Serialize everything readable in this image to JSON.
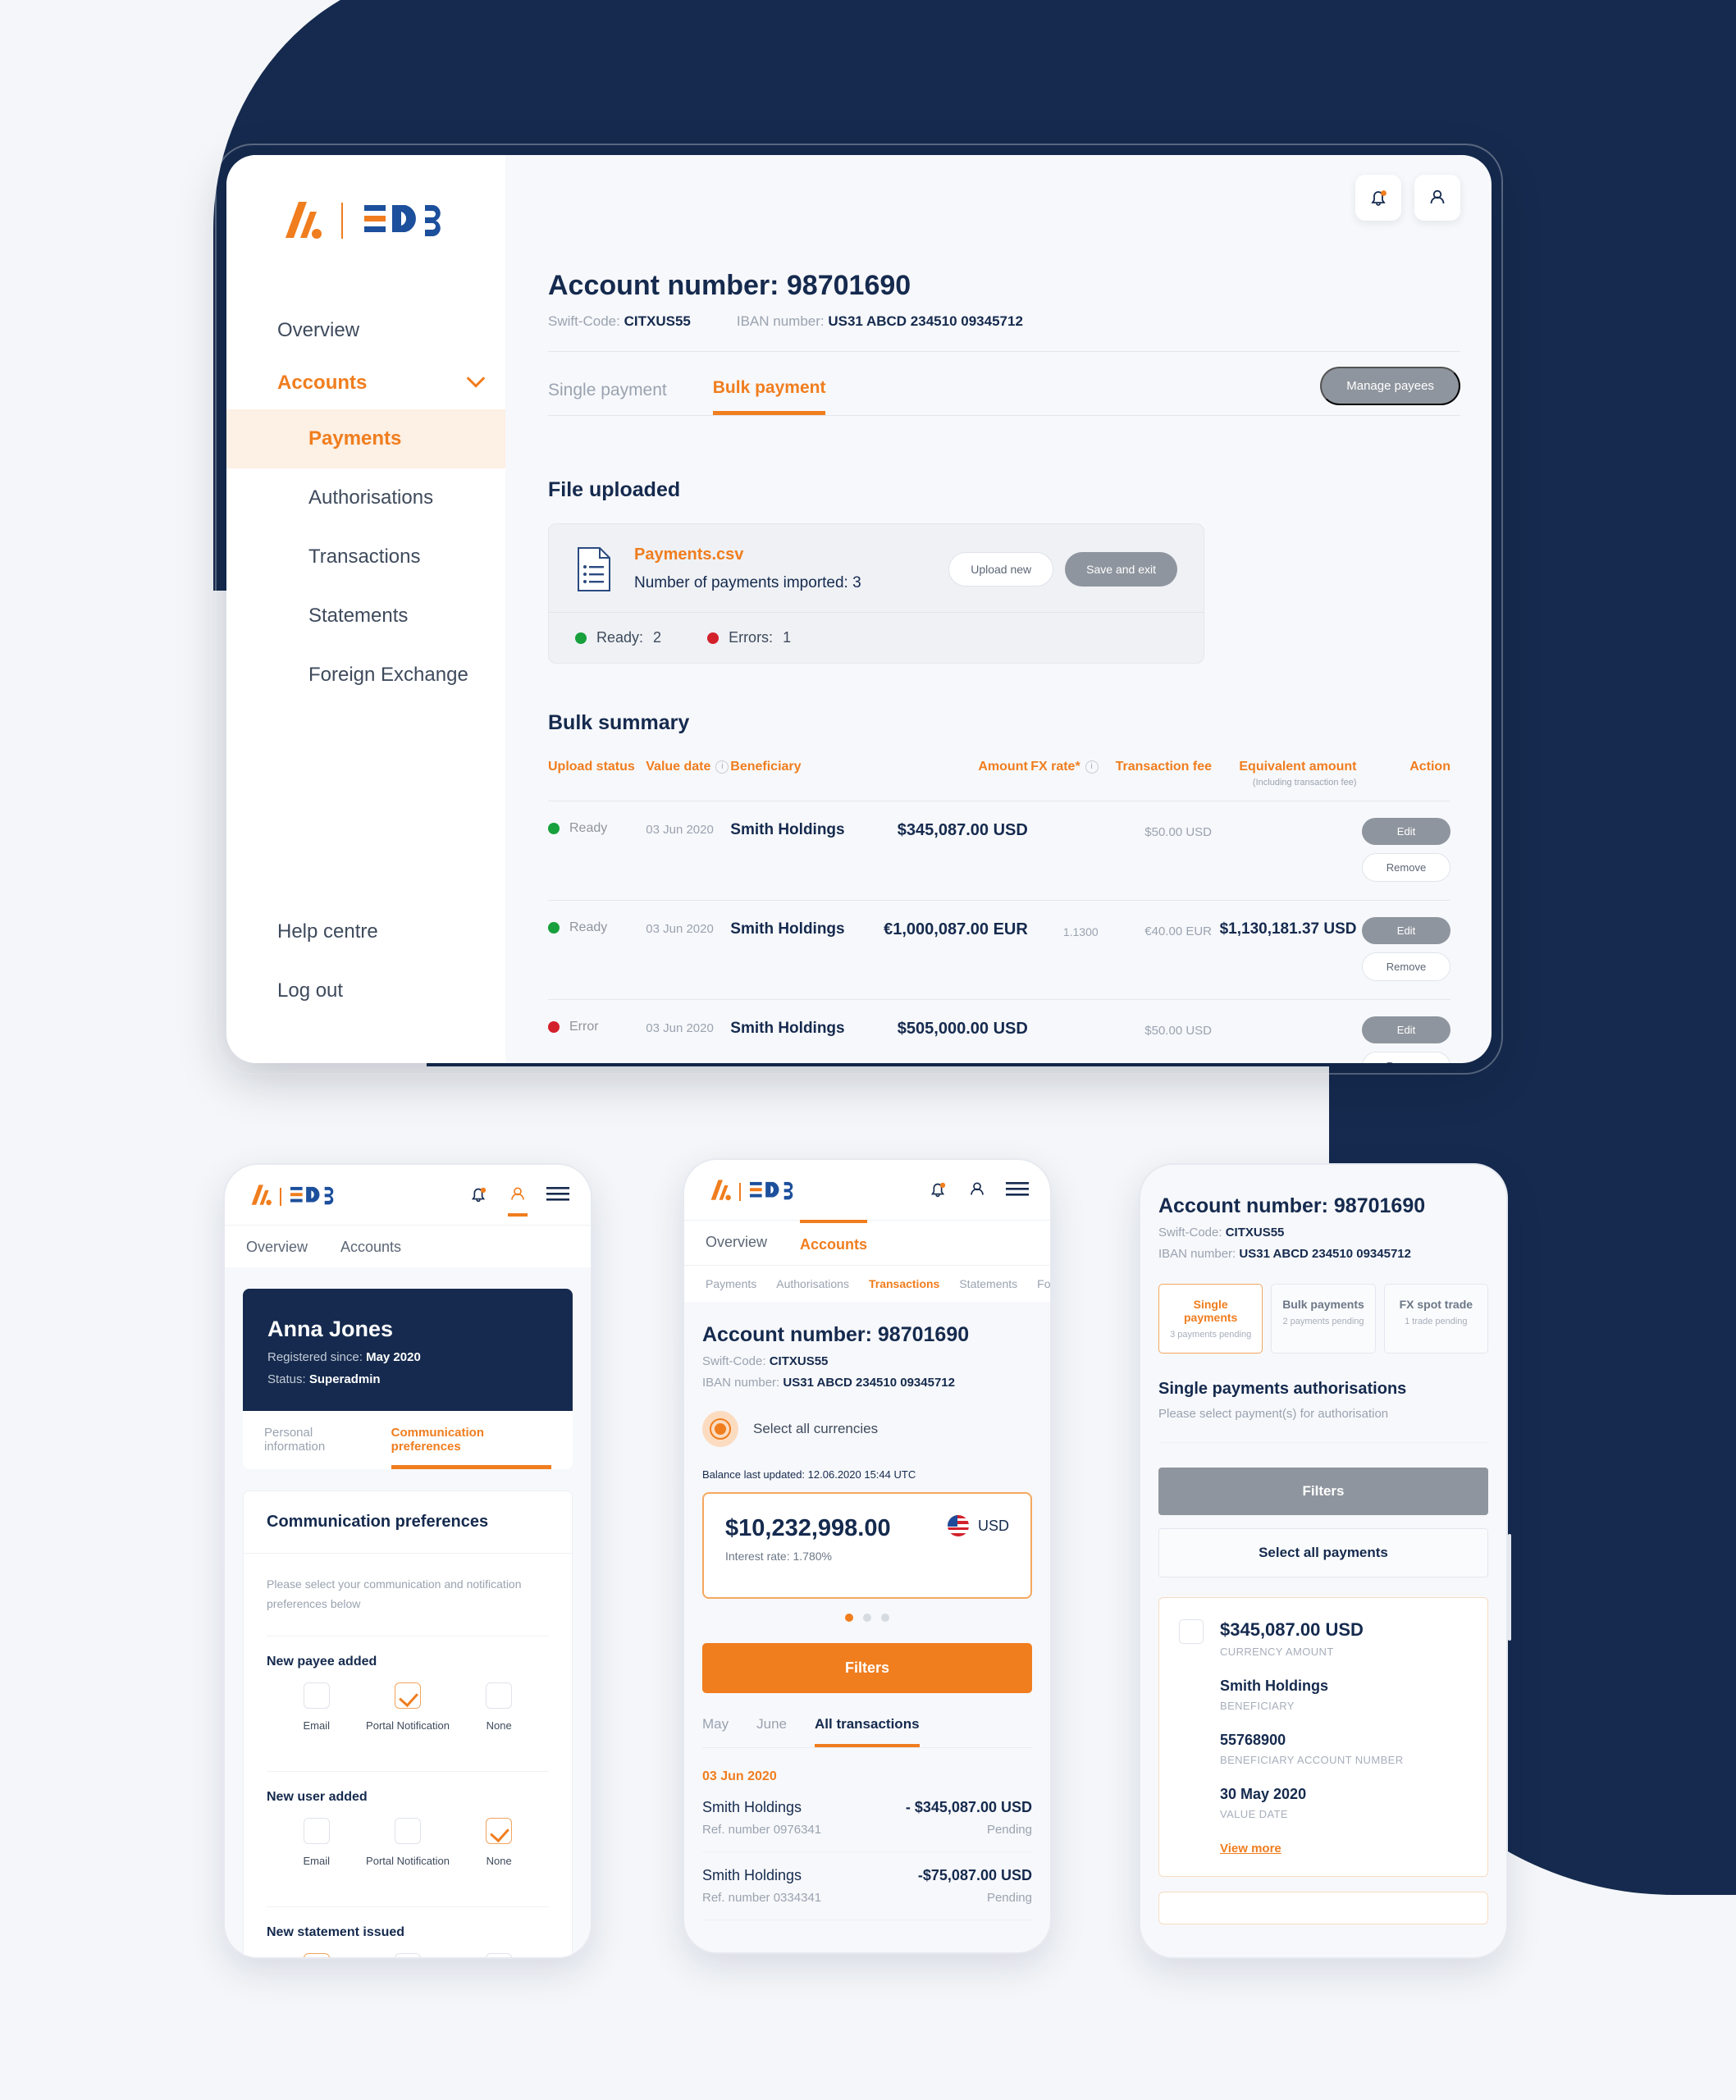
{
  "brand": {
    "logo_name": "hashed-bars-logo",
    "wordmark": "EDB",
    "orange": "#f07d1e",
    "navy": "#152a4e"
  },
  "desktop": {
    "topbar": {
      "bell_icon": "bell-icon",
      "profile_icon": "person-icon"
    },
    "sidebar": {
      "items": [
        {
          "label": "Overview",
          "type": "item"
        },
        {
          "label": "Accounts",
          "type": "group",
          "expanded": true
        },
        {
          "label": "Payments",
          "type": "sub",
          "active": true
        },
        {
          "label": "Authorisations",
          "type": "sub"
        },
        {
          "label": "Transactions",
          "type": "sub"
        },
        {
          "label": "Statements",
          "type": "sub"
        },
        {
          "label": "Foreign Exchange",
          "type": "sub"
        }
      ],
      "bottom": [
        {
          "label": "Help centre"
        },
        {
          "label": "Log out"
        }
      ]
    },
    "account": {
      "title": "Account number: 98701690",
      "swift_label": "Swift-Code:",
      "swift_value": "CITXUS55",
      "iban_label": "IBAN number:",
      "iban_value": "US31 ABCD 234510 09345712"
    },
    "tabs": [
      {
        "label": "Single payment",
        "active": false
      },
      {
        "label": "Bulk payment",
        "active": true
      }
    ],
    "manage_payees": "Manage payees",
    "file_uploaded": {
      "heading": "File uploaded",
      "file_name": "Payments.csv",
      "imported_label": "Number of payments imported:",
      "imported_count": "3",
      "upload_new": "Upload new",
      "save_exit": "Save and exit",
      "ready_label": "Ready:",
      "ready_count": "2",
      "errors_label": "Errors:",
      "errors_count": "1"
    },
    "bulk_summary": {
      "heading": "Bulk summary",
      "columns": [
        "Upload status",
        "Value date",
        "Beneficiary",
        "Amount",
        "FX rate*",
        "Transaction fee",
        "Equivalent amount",
        "Action"
      ],
      "equivalent_sub": "(Including transaction fee)",
      "rows": [
        {
          "status": "Ready",
          "status_color": "green",
          "value_date": "03 Jun 2020",
          "beneficiary": "Smith Holdings",
          "amount": "$345,087.00 USD",
          "fx_rate": "",
          "fee": "$50.00 USD",
          "equivalent": "",
          "edit": "Edit",
          "remove": "Remove"
        },
        {
          "status": "Ready",
          "status_color": "green",
          "value_date": "03 Jun 2020",
          "beneficiary": "Smith Holdings",
          "amount": "€1,000,087.00 EUR",
          "fx_rate": "1.1300",
          "fee": "€40.00 EUR",
          "equivalent": "$1,130,181.37 USD",
          "edit": "Edit",
          "remove": "Remove"
        },
        {
          "status": "Error",
          "status_color": "red",
          "value_date": "03 Jun 2020",
          "beneficiary": "Smith Holdings",
          "amount": "$505,000.00 USD",
          "fx_rate": "",
          "fee": "$50.00 USD",
          "equivalent": "",
          "edit": "Edit",
          "remove": "Remove"
        }
      ]
    }
  },
  "phone1": {
    "tabs": [
      {
        "label": "Overview"
      },
      {
        "label": "Accounts"
      }
    ],
    "icons": {
      "bell": "bell-icon",
      "profile": "person-icon",
      "menu": "hamburger-icon"
    },
    "user": {
      "name": "Anna Jones",
      "registered_label": "Registered since:",
      "registered_value": "May 2020",
      "status_label": "Status:",
      "status_value": "Superadmin"
    },
    "user_tabs": [
      {
        "label": "Personal information",
        "active": false
      },
      {
        "label": "Communication preferences",
        "active": true
      }
    ],
    "card_title": "Communication preferences",
    "hint": "Please select your communication and notification preferences below",
    "groups": [
      {
        "title": "New payee added",
        "options": [
          {
            "label": "Email",
            "checked": false
          },
          {
            "label": "Portal Notification",
            "checked": true
          },
          {
            "label": "None",
            "checked": false
          }
        ]
      },
      {
        "title": "New user added",
        "options": [
          {
            "label": "Email",
            "checked": false
          },
          {
            "label": "Portal Notification",
            "checked": false
          },
          {
            "label": "None",
            "checked": true
          }
        ]
      },
      {
        "title": "New statement issued",
        "options": [
          {
            "label": "",
            "checked": true
          },
          {
            "label": "",
            "checked": false
          },
          {
            "label": "",
            "checked": false
          }
        ]
      }
    ]
  },
  "phone2": {
    "tabs": [
      {
        "label": "Overview",
        "active": false
      },
      {
        "label": "Accounts",
        "active": true
      }
    ],
    "subtabs": [
      {
        "label": "Payments",
        "active": false
      },
      {
        "label": "Authorisations",
        "active": false
      },
      {
        "label": "Transactions",
        "active": true
      },
      {
        "label": "Statements",
        "active": false
      },
      {
        "label": "Foreig",
        "active": false
      }
    ],
    "account": {
      "title": "Account number: 98701690",
      "swift_label": "Swift-Code:",
      "swift_value": "CITXUS55",
      "iban_label": "IBAN number:",
      "iban_value": "US31 ABCD 234510 09345712"
    },
    "select_all_currencies": "Select all currencies",
    "balance_updated_label": "Balance last updated:",
    "balance_updated_value": "12.06.2020  15:44 UTC",
    "balance": {
      "amount": "$10,232,998.00",
      "interest": "Interest rate: 1.780%",
      "currency": "USD",
      "flag": "us-flag-icon"
    },
    "carousel_dots": 3,
    "carousel_active": 0,
    "filters_button": "Filters",
    "month_tabs": [
      {
        "label": "May",
        "active": false
      },
      {
        "label": "June",
        "active": false
      },
      {
        "label": "All transactions",
        "active": true
      }
    ],
    "txn_date": "03 Jun 2020",
    "transactions": [
      {
        "name": "Smith Holdings",
        "amount": "- $345,087.00 USD",
        "ref": "Ref. number 0976341",
        "status": "Pending"
      },
      {
        "name": "Smith Holdings",
        "amount": "-$75,087.00 USD",
        "ref": "Ref. number 0334341",
        "status": "Pending"
      }
    ]
  },
  "phone3": {
    "account": {
      "title": "Account number: 98701690",
      "swift_label": "Swift-Code:",
      "swift_value": "CITXUS55",
      "iban_label": "IBAN number:",
      "iban_value": "US31 ABCD 234510 09345712"
    },
    "segments": [
      {
        "title": "Single payments",
        "sub": "3 payments pending",
        "active": true
      },
      {
        "title": "Bulk payments",
        "sub": "2 payments pending",
        "active": false
      },
      {
        "title": "FX spot trade",
        "sub": "1 trade pending",
        "active": false
      }
    ],
    "heading": "Single payments authorisations",
    "subheading": "Please select payment(s) for authorisation",
    "filters_button": "Filters",
    "select_all_button": "Select all payments",
    "payment": {
      "amount": "$345,087.00 USD",
      "amount_label": "CURRENCY AMOUNT",
      "beneficiary": "Smith Holdings",
      "beneficiary_label": "BENEFICIARY",
      "account_number": "55768900",
      "account_number_label": "BENEFICIARY ACCOUNT NUMBER",
      "value_date": "30 May 2020",
      "value_date_label": "VALUE DATE",
      "view_more": "View more"
    }
  }
}
